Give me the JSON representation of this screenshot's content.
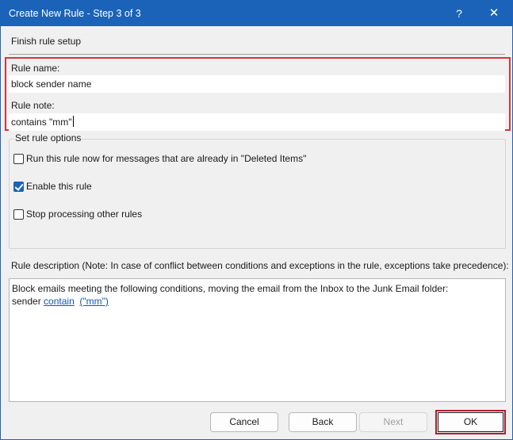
{
  "window": {
    "title": "Create New Rule - Step 3 of 3",
    "help_glyph": "?",
    "close_glyph": "✕",
    "accent_color": "#1a63b8",
    "highlight_color": "#d8343a"
  },
  "setup": {
    "section_title": "Finish rule setup",
    "rule_name_label": "Rule name:",
    "rule_name_value": "block sender name",
    "rule_note_label": "Rule note:",
    "rule_note_value": "contains \"mm\""
  },
  "options": {
    "legend": "Set rule options",
    "items": [
      {
        "label": "Run this rule now for messages that are already in \"Deleted Items\"",
        "checked": false
      },
      {
        "label": "Enable this rule",
        "checked": true
      },
      {
        "label": "Stop processing other rules",
        "checked": false
      }
    ]
  },
  "description": {
    "label": "Rule description (Note: In case of conflict between conditions and exceptions in the rule, exceptions take precedence):",
    "line1": "Block emails meeting the following conditions, moving the email from the Inbox to the Junk Email folder:",
    "line2_prefix": "sender",
    "link_condition": "contain",
    "link_value": "(\"mm\")"
  },
  "buttons": {
    "cancel": "Cancel",
    "back": "Back",
    "next": "Next",
    "ok": "OK"
  }
}
